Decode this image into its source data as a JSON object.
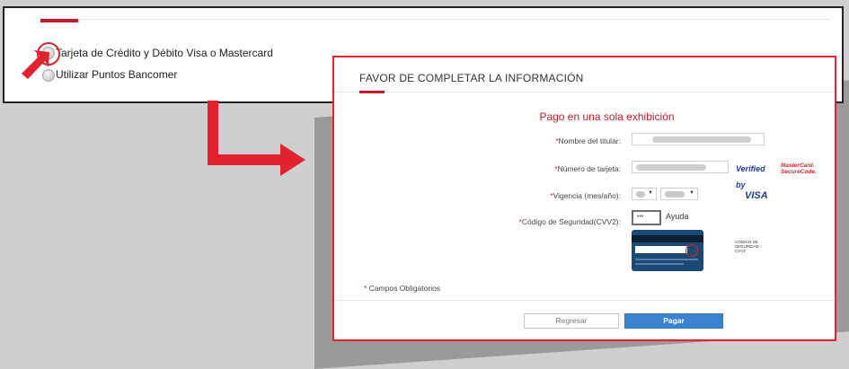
{
  "payment_options": {
    "card_option": "Tarjeta de Crédito y Débito Visa o Mastercard",
    "points_option": "Utilizar Puntos Bancomer"
  },
  "modal": {
    "title": "FAVOR DE COMPLETAR LA INFORMACIÓN",
    "subtitle": "Pago en una sola exhibición",
    "required_mark": "*",
    "fields": {
      "holder_label": "Nombre del titular:",
      "card_number_label": "Número de tarjeta:",
      "validity_label": "Vigencia (mes/año):",
      "cvv_label": "Código de Seguridad(CVV2):"
    },
    "cvv_value": "•••",
    "help_link": "Ayuda",
    "verified_line1": "Verified by",
    "verified_line2": "VISA",
    "securecode_line1": "MasterCard.",
    "securecode_line2": "SecureCode.",
    "cvv_note": "CÓDIGO DE SEGURIDAD CVV2",
    "required_note": "Campos Obligatorios",
    "back_button": "Regresar",
    "pay_button": "Pagar"
  },
  "colors": {
    "accent_red": "#c0182a",
    "arrow_red": "#e3222f",
    "pay_blue": "#3b82cf"
  },
  "icons": [
    "radio-icon",
    "arrow-pointer-icon",
    "elbow-arrow-icon",
    "card-back-icon",
    "dropdown-arrow-icon"
  ]
}
